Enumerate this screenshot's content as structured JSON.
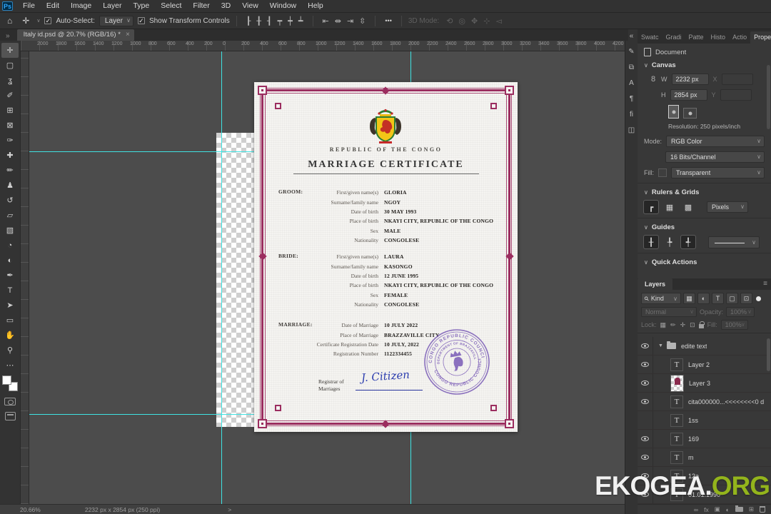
{
  "menu_bar": {
    "logo": "Ps",
    "items": [
      "File",
      "Edit",
      "Image",
      "Layer",
      "Type",
      "Select",
      "Filter",
      "3D",
      "View",
      "Window",
      "Help"
    ]
  },
  "options_bar": {
    "home_glyph": "⌂",
    "move_glyph": "✛",
    "auto_select_label": "Auto-Select:",
    "target_dropdown": "Layer",
    "show_transform_label": "Show Transform Controls",
    "more_dots": "•••",
    "mode3d_label": "3D Mode:",
    "align_icons": [
      {
        "name": "align-left-icon",
        "glyph": "┠"
      },
      {
        "name": "align-center-h-icon",
        "glyph": "╂"
      },
      {
        "name": "align-right-icon",
        "glyph": "┨"
      },
      {
        "name": "align-top-icon",
        "glyph": "┯"
      },
      {
        "name": "align-middle-icon",
        "glyph": "┿"
      },
      {
        "name": "align-bottom-icon",
        "glyph": "┷"
      }
    ],
    "distribute_icons": [
      {
        "name": "distribute-left-icon",
        "glyph": "⇤"
      },
      {
        "name": "distribute-center-icon",
        "glyph": "⇹"
      },
      {
        "name": "distribute-right-icon",
        "glyph": "⇥"
      },
      {
        "name": "distribute-vertical-icon",
        "glyph": "⇳"
      }
    ],
    "mode3d_icons": [
      {
        "name": "3d-orbit-icon",
        "glyph": "⟲"
      },
      {
        "name": "3d-roll-icon",
        "glyph": "◎"
      },
      {
        "name": "3d-pan-icon",
        "glyph": "✥"
      },
      {
        "name": "3d-slide-icon",
        "glyph": "⊹"
      },
      {
        "name": "3d-scale-icon",
        "glyph": "◅"
      }
    ]
  },
  "document_tab": {
    "title": "Italy id.psd @ 20.7% (RGB/16) *",
    "close_glyph": "×",
    "overflow_glyph": "»"
  },
  "toolbar": {
    "tools": [
      {
        "name": "move-tool",
        "glyph": "✛",
        "selected": true
      },
      {
        "name": "marquee-tool",
        "glyph": "▢"
      },
      {
        "name": "lasso-tool",
        "glyph": "ʓ"
      },
      {
        "name": "quick-selection-tool",
        "glyph": "✐"
      },
      {
        "name": "crop-tool",
        "glyph": "⊞"
      },
      {
        "name": "frame-tool",
        "glyph": "⊠"
      },
      {
        "name": "eyedropper-tool",
        "glyph": "✑"
      },
      {
        "name": "healing-brush-tool",
        "glyph": "✚"
      },
      {
        "name": "brush-tool",
        "glyph": "✏"
      },
      {
        "name": "clone-stamp-tool",
        "glyph": "♟"
      },
      {
        "name": "history-brush-tool",
        "glyph": "↺"
      },
      {
        "name": "eraser-tool",
        "glyph": "▱"
      },
      {
        "name": "gradient-tool",
        "glyph": "▧"
      },
      {
        "name": "blur-tool",
        "glyph": "◔"
      },
      {
        "name": "dodge-tool",
        "glyph": "◐"
      },
      {
        "name": "pen-tool",
        "glyph": "✒"
      },
      {
        "name": "type-tool",
        "glyph": "T"
      },
      {
        "name": "path-selection-tool",
        "glyph": "➤"
      },
      {
        "name": "rectangle-tool",
        "glyph": "▭"
      },
      {
        "name": "hand-tool",
        "glyph": "✋"
      },
      {
        "name": "zoom-tool",
        "glyph": "⚲"
      },
      {
        "name": "more-tools",
        "glyph": "⋯"
      }
    ]
  },
  "ruler": {
    "labels": [
      "2000",
      "1800",
      "1600",
      "1400",
      "1200",
      "1000",
      "800",
      "600",
      "400",
      "200",
      "0",
      "200",
      "400",
      "600",
      "800",
      "1000",
      "1200",
      "1400",
      "1600",
      "1800",
      "2000",
      "2200",
      "2400",
      "2600",
      "2800",
      "3000",
      "3200",
      "3400",
      "3600",
      "3800",
      "4000",
      "4200"
    ]
  },
  "certificate": {
    "republic": "REPUBLIC OF THE CONGO",
    "title": "MARRIAGE CERTIFICATE",
    "sections": [
      {
        "title": "GROOM:",
        "rows": [
          [
            "First/given name(s)",
            "GLORIA"
          ],
          [
            "Surname/family name",
            "NGOY"
          ],
          [
            "Date of birth",
            "30 MAY 1993"
          ],
          [
            "Place of birth",
            "NKAYI CITY, REPUBLIC OF THE CONGO"
          ],
          [
            "Sex",
            "MALE"
          ],
          [
            "Nationality",
            "CONGOLESE"
          ]
        ]
      },
      {
        "title": "BRIDE:",
        "rows": [
          [
            "First/given name(s)",
            "LAURA"
          ],
          [
            "Surname/family name",
            "KASONGO"
          ],
          [
            "Date of birth",
            "12 JUNE 1995"
          ],
          [
            "Place of birth",
            "NKAYI CITY, REPUBLIC OF THE CONGO"
          ],
          [
            "Sex",
            "FEMALE"
          ],
          [
            "Nationality",
            "CONGOLESE"
          ]
        ]
      },
      {
        "title": "MARRIAGE:",
        "rows": [
          [
            "Date of Marriage",
            "10 JULY 2022"
          ],
          [
            "Place of Marriage",
            "BRAZZAVILLE CITY"
          ],
          [
            "Certificate Registration Date",
            "10 JULY, 2022"
          ],
          [
            "Registration Number",
            "1122334455"
          ]
        ]
      }
    ],
    "registrar_line1": "Registrar of",
    "registrar_line2": "Marriages",
    "signature": "J. Citizen",
    "stamp": {
      "ring_outer_top": "CONGO REPUBLIC COUNCIL",
      "ring_inner": "DEPARTMENT OF BRAZZAVILLE CITY",
      "ring_outer_bottom": "CONGO REPUBLIC COUNCIL"
    }
  },
  "dock_icons": [
    {
      "name": "collapse-panels-icon",
      "glyph": "«"
    },
    {
      "name": "brush-settings-panel-icon",
      "glyph": "✎"
    },
    {
      "name": "layer-comps-panel-icon",
      "glyph": "⧉"
    },
    {
      "name": "character-panel-icon",
      "glyph": "A"
    },
    {
      "name": "paragraph-panel-icon",
      "glyph": "¶"
    },
    {
      "name": "glyphs-panel-icon",
      "glyph": "ﬁ"
    },
    {
      "name": "libraries-panel-icon",
      "glyph": "◫"
    }
  ],
  "properties_panel": {
    "tabs": [
      {
        "label": "Swatc",
        "active": false
      },
      {
        "label": "Gradi",
        "active": false
      },
      {
        "label": "Patte",
        "active": false
      },
      {
        "label": "Histo",
        "active": false
      },
      {
        "label": "Actio",
        "active": false
      },
      {
        "label": "Properties",
        "active": true
      }
    ],
    "menu_glyph": "≡",
    "document_label": "Document",
    "canvas_section": "Canvas",
    "w_label": "W",
    "w_value": "2232 px",
    "x_label": "X",
    "h_label": "H",
    "h_value": "2854 px",
    "y_label": "Y",
    "chain_glyph": "8",
    "resolution": "Resolution: 250 pixels/inch",
    "mode_label": "Mode:",
    "mode_value": "RGB Color",
    "bits_value": "16 Bits/Channel",
    "fill_label": "Fill:",
    "fill_value": "Transparent",
    "rulers_section": "Rulers & Grids",
    "ruler_icons": [
      {
        "name": "toggle-rulers-icon",
        "glyph": "┏",
        "sel": true
      },
      {
        "name": "toggle-grid-icon",
        "glyph": "▦",
        "sel": false
      },
      {
        "name": "toggle-pixel-grid-icon",
        "glyph": "▩",
        "sel": false
      }
    ],
    "rulers_unit": "Pixels",
    "guides_section": "Guides",
    "guide_icons": [
      {
        "name": "new-guide-layout-icon",
        "glyph": "╂",
        "sel": true
      },
      {
        "name": "lock-guides-icon",
        "glyph": "╄",
        "sel": false
      },
      {
        "name": "clear-guides-icon",
        "glyph": "╃",
        "sel": true
      }
    ],
    "quick_actions_section": "Quick Actions"
  },
  "layers_panel": {
    "tab": "Layers",
    "menu_glyph": "≡",
    "kind_label": "Kind",
    "search_glyph": "⚲",
    "filter_icons": [
      {
        "name": "filter-pixel-layers-icon",
        "glyph": "▦"
      },
      {
        "name": "filter-adjustment-layers-icon",
        "glyph": "◐"
      },
      {
        "name": "filter-type-layers-icon",
        "glyph": "T"
      },
      {
        "name": "filter-shape-layers-icon",
        "glyph": "▢"
      },
      {
        "name": "filter-smart-objects-icon",
        "glyph": "⊡"
      }
    ],
    "blend_mode": "Normal",
    "opacity_label": "Opacity:",
    "opacity_value": "100%",
    "lock_label": "Lock:",
    "lock_icons": [
      {
        "name": "lock-transparency-icon",
        "glyph": "▦"
      },
      {
        "name": "lock-pixels-icon",
        "glyph": "✏"
      },
      {
        "name": "lock-position-icon",
        "glyph": "✛"
      },
      {
        "name": "lock-artboard-icon",
        "glyph": "⊡"
      }
    ],
    "fill_label": "Fill:",
    "fill_value": "100%",
    "rows": [
      {
        "type": "group",
        "name": "edite text",
        "eye": true
      },
      {
        "type": "text",
        "name": "Layer 2",
        "eye": true
      },
      {
        "type": "image",
        "name": "Layer 3",
        "eye": true
      },
      {
        "type": "text",
        "name": "cita000000...<<<<<<<<0 d",
        "eye": true
      },
      {
        "type": "text",
        "name": "1ss",
        "eye": false
      },
      {
        "type": "text",
        "name": "169",
        "eye": true
      },
      {
        "type": "text",
        "name": "m",
        "eye": true
      },
      {
        "type": "text",
        "name": "12a",
        "eye": true
      },
      {
        "type": "text",
        "name": "01.01.1990",
        "eye": true
      }
    ],
    "bottom_icons": [
      {
        "name": "link-layers-icon",
        "glyph": "∞"
      },
      {
        "name": "layer-effects-icon",
        "glyph": "fx"
      },
      {
        "name": "add-layer-mask-icon",
        "glyph": "▣"
      },
      {
        "name": "new-adjustment-layer-icon",
        "glyph": "◐"
      },
      {
        "name": "new-group-icon",
        "glyph": "__folder"
      },
      {
        "name": "new-layer-icon",
        "glyph": "⊞"
      },
      {
        "name": "delete-layer-icon",
        "glyph": "__trash"
      }
    ]
  },
  "status_bar": {
    "zoom_level": "20.66%",
    "doc_size": "2232 px x 2854 px (250 ppi)",
    "arrow": ">"
  },
  "watermark": {
    "white_part": "EKOGEA.",
    "green_part": "ORG"
  },
  "colors": {
    "guide_cyan": "#3fe3e3",
    "cert_maroon": "#9b2d5f",
    "stamp_purple": "#7d5fb8",
    "watermark_green": "#93b41c",
    "accent_blue": "#31a8ff"
  }
}
